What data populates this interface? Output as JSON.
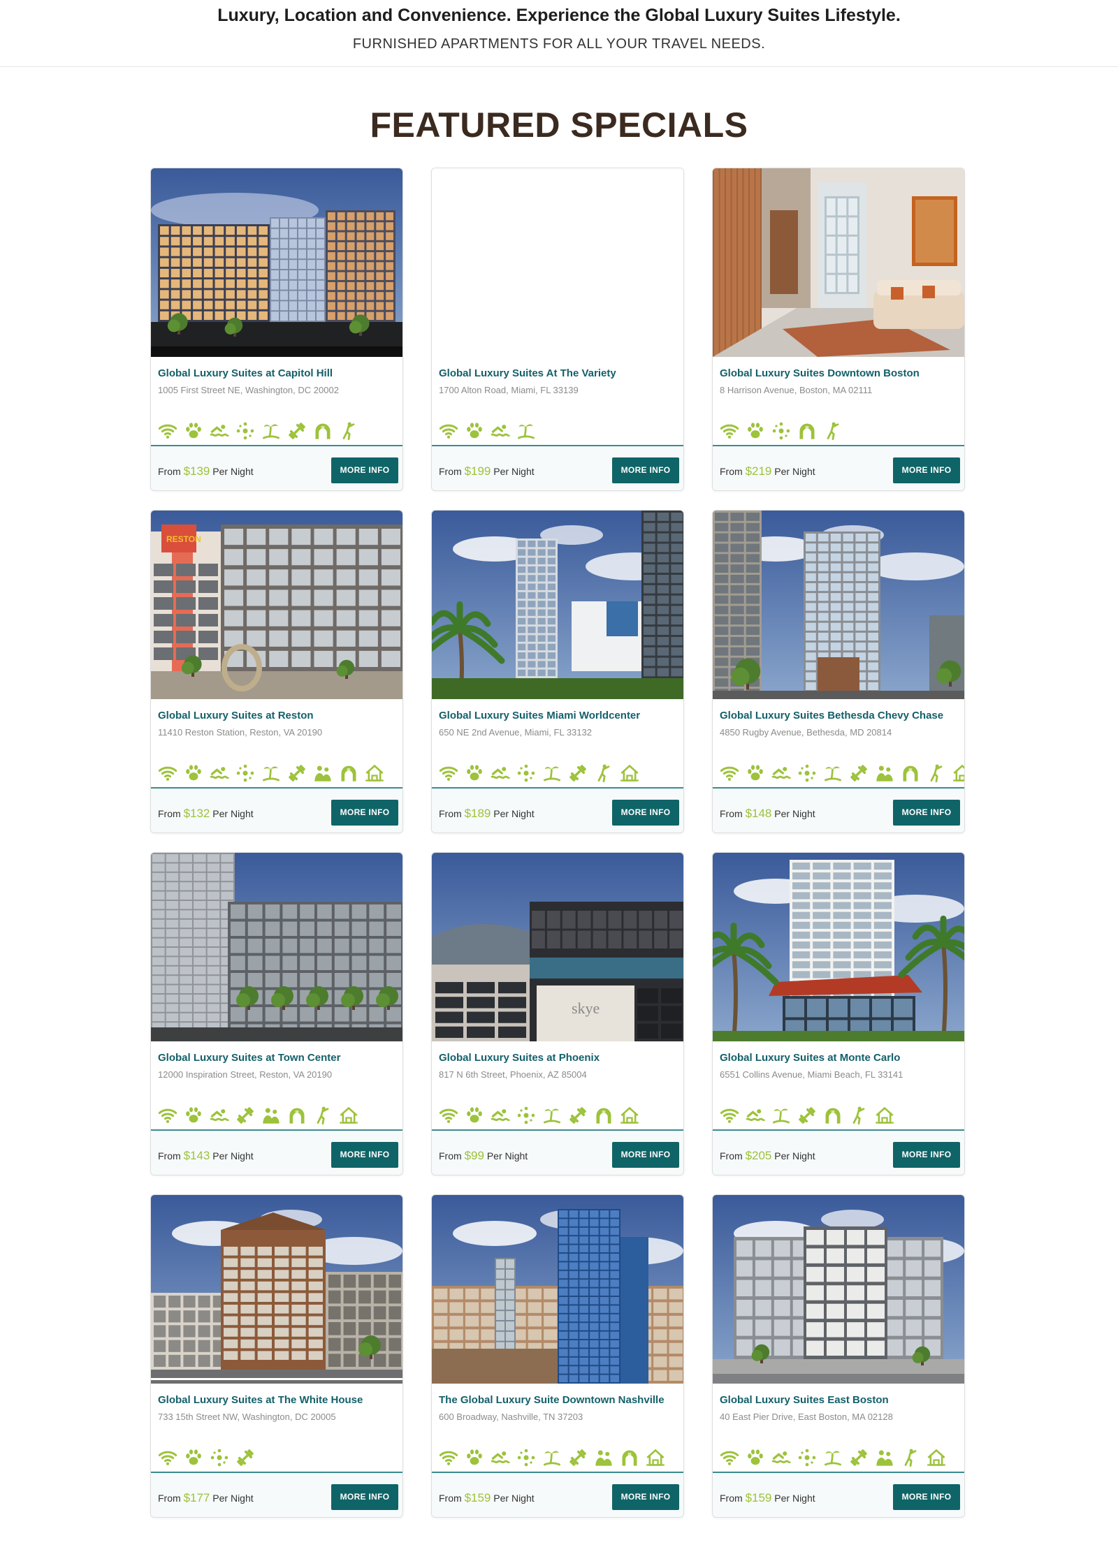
{
  "header": {
    "tagline": "Luxury, Location and Convenience. Experience the Global Luxury Suites Lifestyle.",
    "subtag": "FURNISHED APARTMENTS FOR ALL YOUR TRAVEL NEEDS."
  },
  "section_title": "FEATURED SPECIALS",
  "colors": {
    "accent": "#0f6467",
    "price": "#9dc23b",
    "title": "#3b2a1f",
    "icon": "#9dc23b"
  },
  "labels": {
    "from": "From",
    "per_night": "Per Night",
    "more_info": "MORE INFO"
  },
  "properties": [
    {
      "name": "Global Luxury Suites at Capitol Hill",
      "address": "1005 First Street NE, Washington, DC 20002",
      "price": "$139",
      "photo": "night-building",
      "amenities": [
        "wifi-icon",
        "pet-icon",
        "pool-icon",
        "sparkle-icon",
        "beach-icon",
        "fitness-icon",
        "playground-icon",
        "golf-icon"
      ]
    },
    {
      "name": "Global Luxury Suites At The Variety",
      "address": "1700 Alton Road, Miami, FL 33139",
      "price": "$199",
      "photo": "blank",
      "amenities": [
        "wifi-icon",
        "pet-icon",
        "pool-icon",
        "beach-icon"
      ]
    },
    {
      "name": "Global Luxury Suites Downtown Boston",
      "address": "8 Harrison Avenue, Boston, MA 02111",
      "price": "$219",
      "photo": "lobby",
      "amenities": [
        "wifi-icon",
        "pet-icon",
        "sparkle-icon",
        "playground-icon",
        "golf-icon"
      ]
    },
    {
      "name": "Global Luxury Suites at Reston",
      "address": "11410 Reston Station, Reston, VA 20190",
      "price": "$132",
      "photo": "midrise",
      "amenities": [
        "wifi-icon",
        "pet-icon",
        "pool-icon",
        "sparkle-icon",
        "beach-icon",
        "fitness-icon",
        "business-icon",
        "playground-icon",
        "home-icon"
      ]
    },
    {
      "name": "Global Luxury Suites Miami Worldcenter",
      "address": "650 NE 2nd Avenue, Miami, FL 33132",
      "price": "$189",
      "photo": "tower-sky",
      "amenities": [
        "wifi-icon",
        "pet-icon",
        "pool-icon",
        "sparkle-icon",
        "beach-icon",
        "fitness-icon",
        "golf-icon",
        "home-icon"
      ]
    },
    {
      "name": "Global Luxury Suites Bethesda Chevy Chase",
      "address": "4850 Rugby Avenue, Bethesda, MD 20814",
      "price": "$148",
      "photo": "tower-glass",
      "amenities": [
        "wifi-icon",
        "pet-icon",
        "pool-icon",
        "sparkle-icon",
        "beach-icon",
        "fitness-icon",
        "business-icon",
        "playground-icon",
        "golf-icon",
        "home-icon"
      ]
    },
    {
      "name": "Global Luxury Suites at Town Center",
      "address": "12000 Inspiration Street, Reston, VA 20190",
      "price": "$143",
      "photo": "gray-modern",
      "amenities": [
        "wifi-icon",
        "pet-icon",
        "pool-icon",
        "fitness-icon",
        "business-icon",
        "playground-icon",
        "golf-icon",
        "home-icon"
      ]
    },
    {
      "name": "Global Luxury Suites at Phoenix",
      "address": "817 N 6th Street, Phoenix, AZ 85004",
      "price": "$99",
      "photo": "rooftop",
      "amenities": [
        "wifi-icon",
        "pet-icon",
        "pool-icon",
        "sparkle-icon",
        "beach-icon",
        "fitness-icon",
        "playground-icon",
        "home-icon"
      ]
    },
    {
      "name": "Global Luxury Suites at Monte Carlo",
      "address": "6551 Collins Avenue, Miami Beach, FL 33141",
      "price": "$205",
      "photo": "palm-tower",
      "amenities": [
        "wifi-icon",
        "pool-icon",
        "beach-icon",
        "fitness-icon",
        "playground-icon",
        "golf-icon",
        "home-icon"
      ]
    },
    {
      "name": "Global Luxury Suites at The White House",
      "address": "733 15th Street NW, Washington, DC 20005",
      "price": "$177",
      "photo": "brick-historic",
      "amenities": [
        "wifi-icon",
        "pet-icon",
        "sparkle-icon",
        "fitness-icon"
      ]
    },
    {
      "name": "The Global Luxury Suite Downtown Nashville",
      "address": "600 Broadway, Nashville, TN 37203",
      "price": "$159",
      "photo": "glass-skyline",
      "amenities": [
        "wifi-icon",
        "pet-icon",
        "pool-icon",
        "sparkle-icon",
        "beach-icon",
        "fitness-icon",
        "business-icon",
        "playground-icon",
        "home-icon"
      ]
    },
    {
      "name": "Global Luxury Suites East Boston",
      "address": "40 East Pier Drive, East Boston, MA 02128",
      "price": "$159",
      "photo": "gray-apartment",
      "amenities": [
        "wifi-icon",
        "pet-icon",
        "pool-icon",
        "sparkle-icon",
        "beach-icon",
        "fitness-icon",
        "business-icon",
        "golf-icon",
        "home-icon"
      ]
    }
  ]
}
